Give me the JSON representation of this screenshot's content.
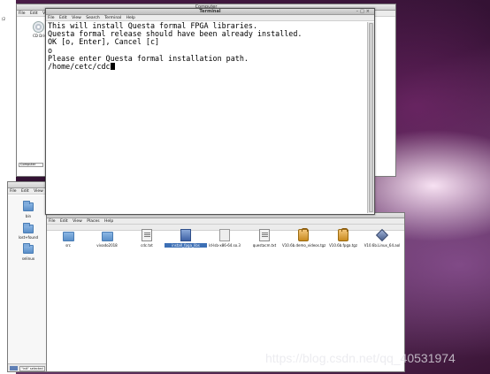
{
  "left_strip": {
    "label": "(2"
  },
  "computer_window": {
    "title": "Computer",
    "menu": [
      "File",
      "Edit",
      "View"
    ],
    "cd_label": "CD Drive",
    "status": "Computer"
  },
  "terminal": {
    "title": "Terminal",
    "menu": [
      "File",
      "Edit",
      "View",
      "Search",
      "Terminal",
      "Help"
    ],
    "lines": [
      "This will install Questa formal FPGA libraries.",
      "Questa formal release should have been already installed.",
      "OK [o, Enter], Cancel [c]",
      "o",
      "Please enter Questa formal installation path.",
      "/home/cetc/cdc"
    ]
  },
  "left_window": {
    "menu": [
      "File",
      "Edit",
      "View",
      "P"
    ],
    "folders": [
      "bin",
      "lost+found",
      "selinux"
    ],
    "status": "\"init\" selected"
  },
  "files_window": {
    "menu": [
      "File",
      "Edit",
      "View",
      "Places",
      "Help"
    ],
    "items": [
      {
        "name": "src",
        "type": "folder"
      },
      {
        "name": "vivado2018",
        "type": "folder"
      },
      {
        "name": "cdc.txt",
        "type": "doc"
      },
      {
        "name": "install_fpga_libs",
        "type": "script",
        "selected": true
      },
      {
        "name": "ld-lsb-x86-64.so.3",
        "type": "lib"
      },
      {
        "name": "questacm.txt",
        "type": "doc"
      },
      {
        "name": "V10.6b.demo_videos.tgz",
        "type": "tgz"
      },
      {
        "name": "V10.6b.fpga.tgz",
        "type": "tgz"
      },
      {
        "name": "V10.6b.Linux_64.aol",
        "type": "diamond"
      }
    ]
  },
  "watermark": "https://blog.csdn.net/qq_40531974"
}
